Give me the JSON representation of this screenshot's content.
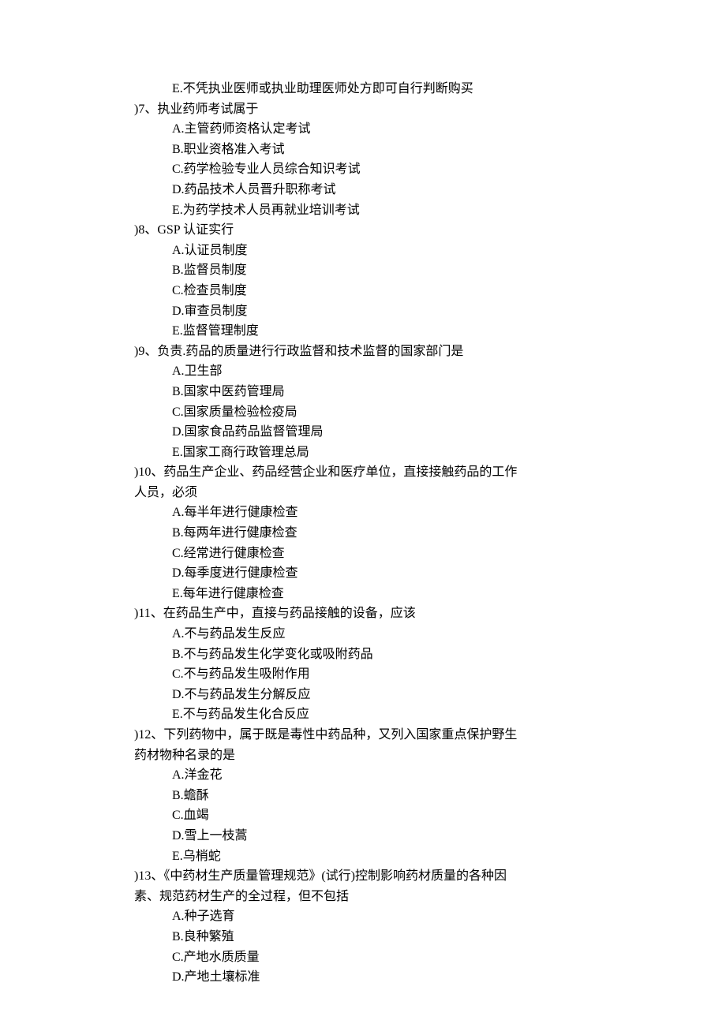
{
  "items": [
    {
      "type": "option",
      "text": "E.不凭执业医师或执业助理医师处方即可自行判断购买"
    },
    {
      "type": "question",
      "text": ")7、执业药师考试属于"
    },
    {
      "type": "option",
      "text": "A.主管药师资格认定考试"
    },
    {
      "type": "option",
      "text": "B.职业资格准入考试"
    },
    {
      "type": "option",
      "text": "C.药学检验专业人员综合知识考试"
    },
    {
      "type": "option",
      "text": "D.药品技术人员晋升职称考试"
    },
    {
      "type": "option",
      "text": "E.为药学技术人员再就业培训考试"
    },
    {
      "type": "question",
      "text": ")8、GSP 认证实行"
    },
    {
      "type": "option",
      "text": "A.认证员制度"
    },
    {
      "type": "option",
      "text": "B.监督员制度"
    },
    {
      "type": "option",
      "text": "C.检查员制度"
    },
    {
      "type": "option",
      "text": "D.审查员制度"
    },
    {
      "type": "option",
      "text": "E.监督管理制度"
    },
    {
      "type": "question",
      "text": ")9、负责.药品的质量进行行政监督和技术监督的国家部门是"
    },
    {
      "type": "option",
      "text": "A.卫生部"
    },
    {
      "type": "option",
      "text": "B.国家中医药管理局"
    },
    {
      "type": "option",
      "text": "C.国家质量检验检疫局"
    },
    {
      "type": "option",
      "text": "D.国家食品药品监督管理局"
    },
    {
      "type": "option",
      "text": "E.国家工商行政管理总局"
    },
    {
      "type": "question",
      "text": ")10、药品生产企业、药品经营企业和医疗单位，直接接触药品的工作"
    },
    {
      "type": "cont",
      "text": "人员，必须"
    },
    {
      "type": "option",
      "text": "A.每半年进行健康检查"
    },
    {
      "type": "option",
      "text": "B.每两年进行健康检查"
    },
    {
      "type": "option",
      "text": "C.经常进行健康检查"
    },
    {
      "type": "option",
      "text": "D.每季度进行健康检查"
    },
    {
      "type": "option",
      "text": "E.每年进行健康检查"
    },
    {
      "type": "question",
      "text": ")11、在药品生产中，直接与药品接触的设备，应该"
    },
    {
      "type": "option",
      "text": "A.不与药品发生反应"
    },
    {
      "type": "option",
      "text": "B.不与药品发生化学变化或吸附药品"
    },
    {
      "type": "option",
      "text": "C.不与药品发生吸附作用"
    },
    {
      "type": "option",
      "text": "D.不与药品发生分解反应"
    },
    {
      "type": "option",
      "text": "E.不与药品发生化合反应"
    },
    {
      "type": "question",
      "text": ")12、下列药物中，属于既是毒性中药品种，又列入国家重点保护野生"
    },
    {
      "type": "cont",
      "text": "药材物种名录的是"
    },
    {
      "type": "option",
      "text": "A.洋金花"
    },
    {
      "type": "option",
      "text": "B.蟾酥"
    },
    {
      "type": "option",
      "text": "C.血竭"
    },
    {
      "type": "option",
      "text": "D.雪上一枝蒿"
    },
    {
      "type": "option",
      "text": "E.乌梢蛇"
    },
    {
      "type": "question",
      "text": ")13、《中药材生产质量管理规范》(试行)控制影响药材质量的各种因"
    },
    {
      "type": "cont",
      "text": "素、规范药材生产的全过程，但不包括"
    },
    {
      "type": "option",
      "text": "A.种子选育"
    },
    {
      "type": "option",
      "text": "B.良种繁殖"
    },
    {
      "type": "option",
      "text": "C.产地水质质量"
    },
    {
      "type": "option",
      "text": "D.产地土壤标准"
    }
  ]
}
